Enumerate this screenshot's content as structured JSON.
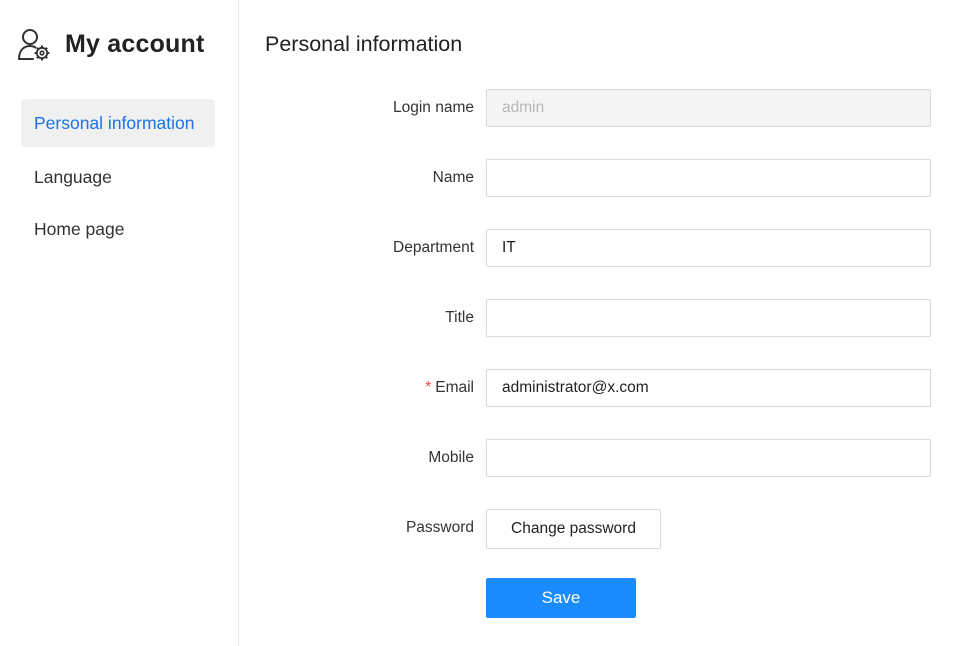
{
  "sidebar": {
    "brand_icon": "user-gear-icon",
    "title": "My account",
    "items": [
      {
        "label": "Personal information",
        "active": true
      },
      {
        "label": "Language",
        "active": false
      },
      {
        "label": "Home page",
        "active": false
      }
    ]
  },
  "main": {
    "title": "Personal information",
    "fields": {
      "login_name": {
        "label": "Login name",
        "value": "admin",
        "disabled": true
      },
      "name": {
        "label": "Name",
        "value": ""
      },
      "department": {
        "label": "Department",
        "value": "IT"
      },
      "title": {
        "label": "Title",
        "value": ""
      },
      "email": {
        "label": "Email",
        "value": "administrator@x.com",
        "required_mark": "*"
      },
      "mobile": {
        "label": "Mobile",
        "value": ""
      },
      "password": {
        "label": "Password",
        "button_label": "Change password"
      }
    },
    "save_label": "Save"
  },
  "colors": {
    "accent": "#1a73e8",
    "primary_button": "#1b8cff",
    "required": "#e5484d"
  }
}
